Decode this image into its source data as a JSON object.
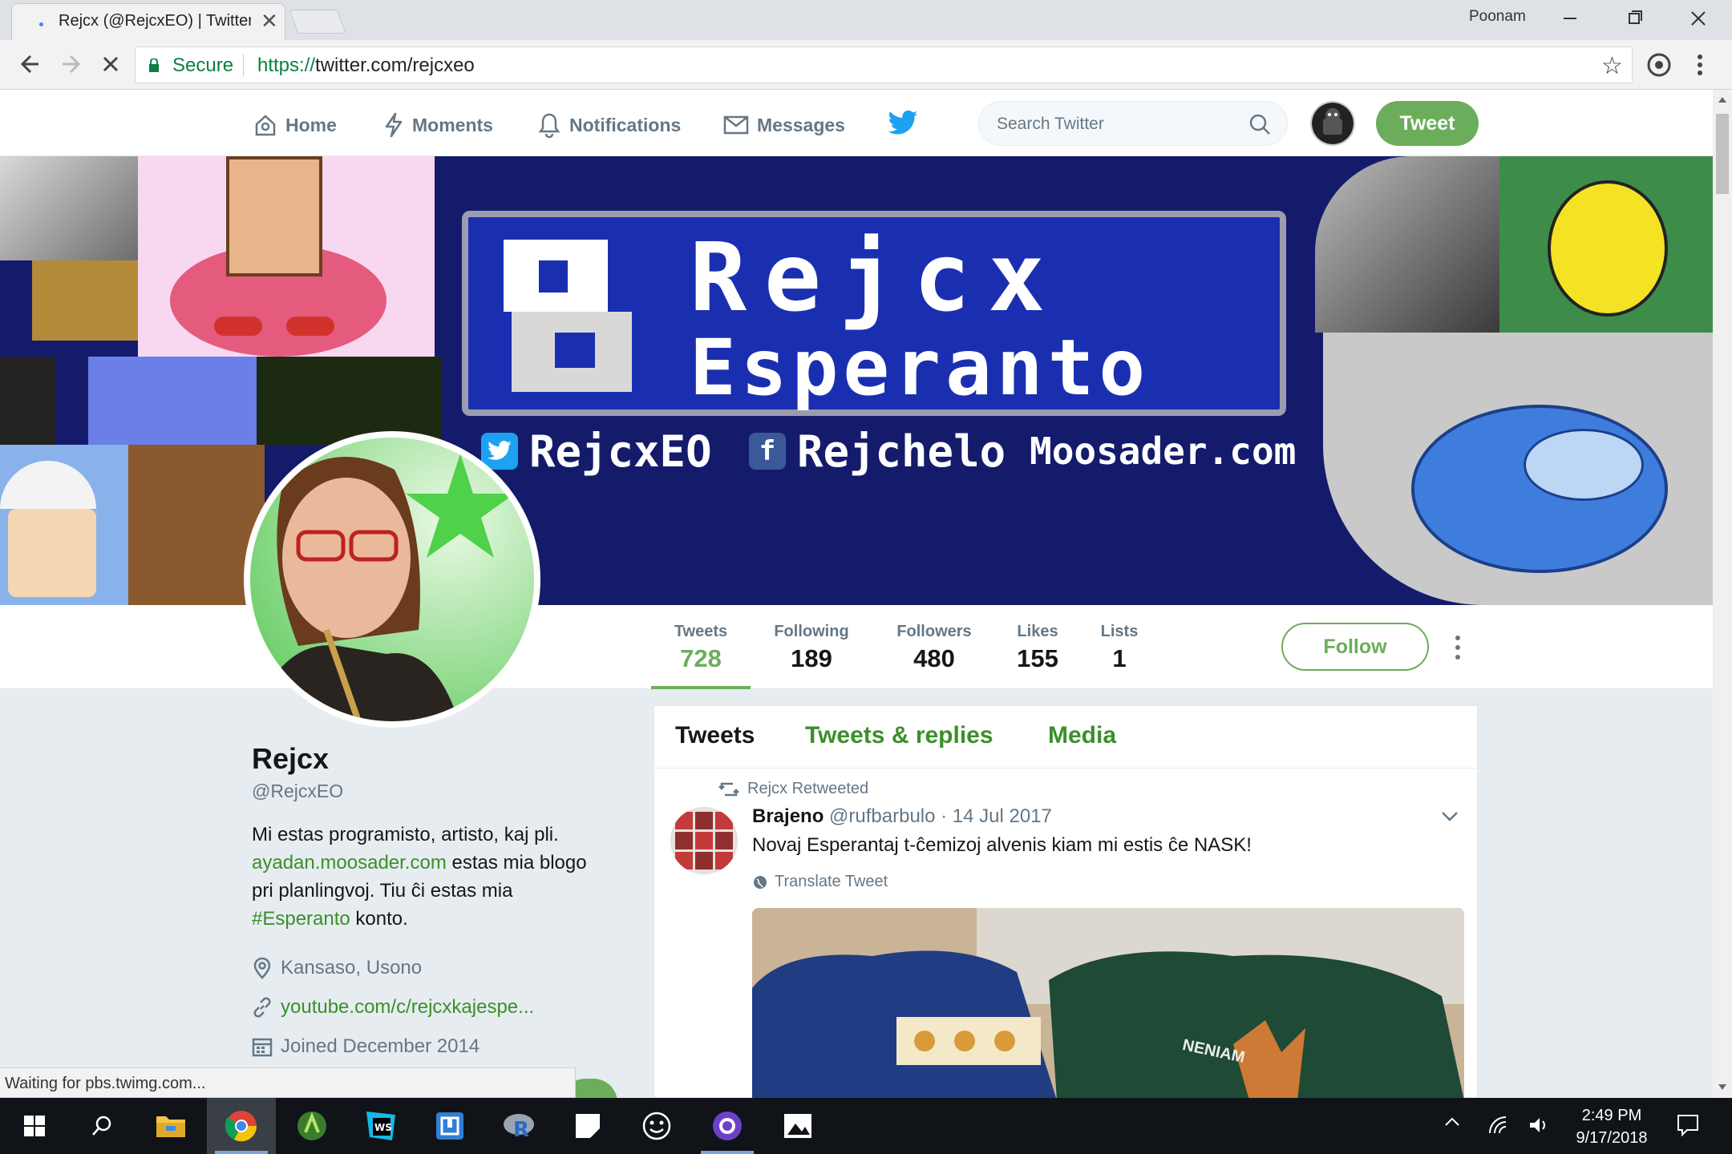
{
  "browser": {
    "tab_title": "Rejcx (@RejcxEO) | Twitter",
    "close_tab": "✕",
    "user_name": "Poonam",
    "secure_label": "Secure",
    "url_scheme": "https://",
    "url_rest": "twitter.com/rejcxeo",
    "status_text": "Waiting for pbs.twimg.com..."
  },
  "nav": {
    "home": "Home",
    "moments": "Moments",
    "notifications": "Notifications",
    "messages": "Messages",
    "search_placeholder": "Search Twitter",
    "tweet_button": "Tweet"
  },
  "banner": {
    "title_line1": "Rejcx",
    "title_line2": "Esperanto",
    "twitter_handle": "RejcxEO",
    "facebook_handle": "Rejchelo",
    "website": "Moosader.com"
  },
  "stats": [
    {
      "label": "Tweets",
      "value": "728"
    },
    {
      "label": "Following",
      "value": "189"
    },
    {
      "label": "Followers",
      "value": "480"
    },
    {
      "label": "Likes",
      "value": "155"
    },
    {
      "label": "Lists",
      "value": "1"
    }
  ],
  "profile": {
    "follow_label": "Follow",
    "name": "Rejcx",
    "handle": "@RejcxEO",
    "bio_1": "Mi estas programisto, artisto, kaj pli.",
    "bio_link": "ayadan.moosader.com",
    "bio_2": " estas mia blogo pri planlingvoj. Tiu ĉi estas mia ",
    "bio_hashtag": "#Esperanto",
    "bio_3": " konto.",
    "location": "Kansaso, Usono",
    "website": "youtube.com/c/rejcxkajespe...",
    "joined": "Joined December 2014"
  },
  "timeline": {
    "tabs": [
      "Tweets",
      "Tweets & replies",
      "Media"
    ],
    "retweet_label": "Rejcx Retweeted",
    "author_name": "Brajeno",
    "author_handle": "@rufbarbulo",
    "date": "· 14 Jul 2017",
    "text": "Novaj Esperantaj t-ĉemizoj alvenis kiam mi estis ĉe NASK!",
    "translate": "Translate Tweet",
    "image_text": "NENIAM"
  },
  "taskbar": {
    "time": "2:49 PM",
    "date": "9/17/2018"
  },
  "colors": {
    "accent": "#6cad5c",
    "link": "#3b8f2a",
    "banner_bg": "#151b6b"
  }
}
